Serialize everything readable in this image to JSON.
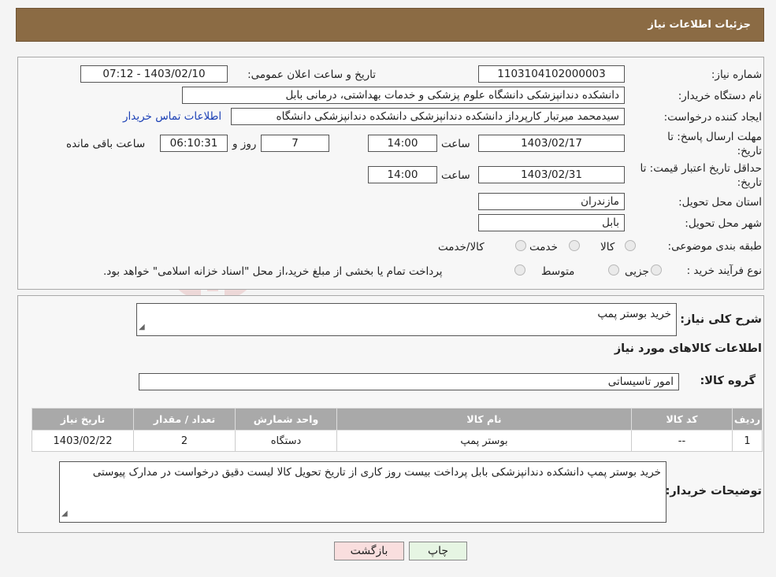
{
  "header": {
    "title": "جزئیات اطلاعات نیاز"
  },
  "form": {
    "need_number_label": "شماره نیاز:",
    "need_number": "1103104102000003",
    "announce_label": "تاریخ و ساعت اعلان عمومی:",
    "announce_value": "1403/02/10 - 07:12",
    "buyer_org_label": "نام دستگاه خریدار:",
    "buyer_org": "دانشکده دندانپزشکی دانشگاه علوم پزشکی و خدمات بهداشتی، درمانی بابل",
    "creator_label": "ایجاد کننده درخواست:",
    "creator": "سیدمحمد میرتبار کارپرداز دانشکده دندانپزشکی دانشکده دندانپزشکی دانشگاه",
    "contact_link": "اطلاعات تماس خریدار",
    "deadline_label_1": "مهلت ارسال پاسخ: تا",
    "deadline_label_2": "تاریخ:",
    "deadline_date": "1403/02/17",
    "time_label": "ساعت",
    "deadline_time": "14:00",
    "days_value": "7",
    "days_label": "روز و",
    "remaining_time": "06:10:31",
    "remaining_label": "ساعت باقی مانده",
    "validity_label_1": "حداقل تاریخ اعتبار قیمت: تا",
    "validity_label_2": "تاریخ:",
    "validity_date": "1403/02/31",
    "validity_time": "14:00",
    "province_label": "استان محل تحویل:",
    "province": "مازندران",
    "city_label": "شهر محل تحویل:",
    "city": "بابل",
    "category_label": "طبقه بندی موضوعی:",
    "category_options": [
      "کالا",
      "خدمت",
      "کالا/خدمت"
    ],
    "process_label": "نوع فرآیند خرید :",
    "process_options": [
      "جزیی",
      "متوسط"
    ],
    "process_note": "پرداخت تمام یا بخشی از مبلغ خرید،از محل \"اسناد خزانه اسلامی\" خواهد بود."
  },
  "details": {
    "summary_label": "شرح کلی نیاز:",
    "summary": "خرید  بوستر پمپ",
    "goods_info_title": "اطلاعات کالاهای مورد نیاز",
    "group_label": "گروه کالا:",
    "group": "امور تاسیساتی",
    "table": {
      "headers": [
        "ردیف",
        "کد کالا",
        "نام کالا",
        "واحد شمارش",
        "تعداد / مقدار",
        "تاریخ نیاز"
      ],
      "rows": [
        [
          "1",
          "--",
          "بوستر پمپ",
          "دستگاه",
          "2",
          "1403/02/22"
        ]
      ]
    },
    "buyer_notes_label": "توضیحات خریدار:",
    "buyer_notes": "خرید بوستر پمپ دانشکده دندانپزشکی بابل پرداخت  بیست روز کاری از تاریخ تحویل کالا لیست دقیق درخواست در مدارک پیوستی"
  },
  "buttons": {
    "print": "چاپ",
    "back": "بازگشت"
  },
  "watermark": {
    "text": "AriaTender.neT"
  },
  "colors": {
    "header_bg": "#8b6b44",
    "link": "#1a3fb5",
    "back_button_bg": "#f9dede",
    "print_button_bg": "#e6f5e3"
  }
}
